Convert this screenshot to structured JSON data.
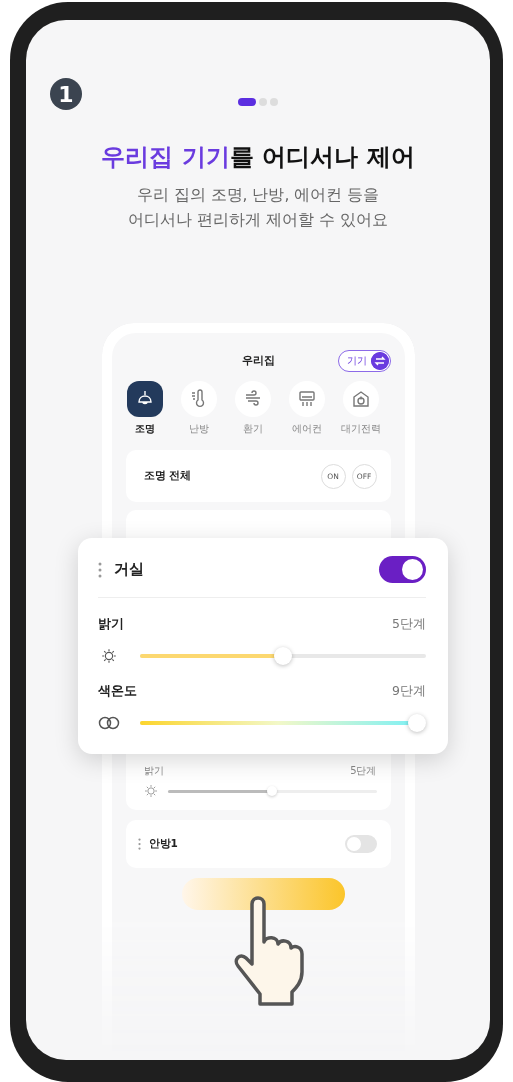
{
  "step_badge": "1",
  "pager": [
    {
      "selected": true
    },
    {
      "selected": false
    },
    {
      "selected": false
    }
  ],
  "headline": "**우리집 기기**를 어디서나 제어",
  "subtitle": "우리 집의 조명, 난방, 에어컨 등을\n어디서나 편리하게 제어할 수 있어요",
  "mock": {
    "title": "우리집",
    "mode_toggle": "기기",
    "categories": [
      {
        "label": "조명",
        "kind": "lamp",
        "selected": true
      },
      {
        "label": "난방",
        "kind": "heat",
        "selected": false
      },
      {
        "label": "환기",
        "kind": "wind",
        "selected": false
      },
      {
        "label": "에어컨",
        "kind": "aircon",
        "selected": false
      },
      {
        "label": "대기전력",
        "kind": "power",
        "selected": false
      }
    ],
    "all_lights": {
      "label": "조명 전체",
      "buttons": [
        "ON",
        "OFF"
      ]
    },
    "room_card_behind": {
      "label": "밝기",
      "reading": "5단계",
      "level": 0.5
    },
    "rooms": [
      {
        "name": "안방1",
        "on": false
      }
    ]
  },
  "room_card": {
    "name": "거실",
    "on": true,
    "sliders": [
      {
        "kind": "brightness",
        "label": "밝기",
        "reading": "5단계",
        "level": 0.5
      },
      {
        "kind": "color_temp",
        "label": "색온도",
        "reading": "9단계",
        "level": 1
      }
    ]
  }
}
